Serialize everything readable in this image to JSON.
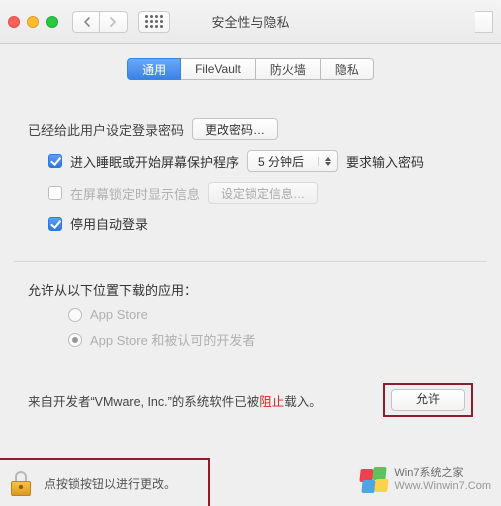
{
  "window": {
    "title": "安全性与隐私"
  },
  "tabs": [
    {
      "label": "通用",
      "active": true
    },
    {
      "label": "FileVault",
      "active": false
    },
    {
      "label": "防火墙",
      "active": false
    },
    {
      "label": "隐私",
      "active": false
    }
  ],
  "password": {
    "status_text": "已经给此用户设定登录密码",
    "change_btn": "更改密码…"
  },
  "sleep_lock": {
    "checked": true,
    "prefix": "进入睡眠或开始屏幕保护程序",
    "delay_value": "5 分钟后",
    "suffix": "要求输入密码"
  },
  "lock_message": {
    "checked": false,
    "label": "在屏幕锁定时显示信息",
    "set_btn": "设定锁定信息…"
  },
  "auto_login": {
    "checked": true,
    "label": "停用自动登录"
  },
  "downloads": {
    "heading": "允许从以下位置下载的应用：",
    "opt1": "App Store",
    "opt2": "App Store 和被认可的开发者",
    "selected": 2
  },
  "blocked": {
    "prefix": "来自开发者“",
    "developer": "VMware, Inc.",
    "mid": "”的系统软件已被",
    "stop": "阻止",
    "suffix": "载入。",
    "allow_btn": "允许"
  },
  "lockbar": {
    "text": "点按锁按钮以进行更改。"
  },
  "watermark": {
    "line1": "Win7系统之家",
    "line2": "Www.Winwin7.Com"
  }
}
